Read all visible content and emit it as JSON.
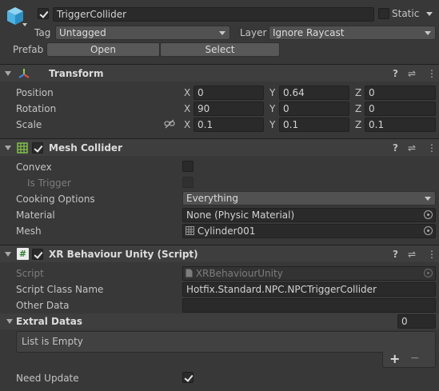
{
  "header": {
    "object_name": "TriggerCollider",
    "static_label": "Static",
    "tag_label": "Tag",
    "tag_value": "Untagged",
    "layer_label": "Layer",
    "layer_value": "Ignore Raycast",
    "prefab_label": "Prefab",
    "open_label": "Open",
    "select_label": "Select"
  },
  "transform": {
    "title": "Transform",
    "position_label": "Position",
    "rotation_label": "Rotation",
    "scale_label": "Scale",
    "axis_x": "X",
    "axis_y": "Y",
    "axis_z": "Z",
    "position": {
      "x": "0",
      "y": "0.64",
      "z": "0"
    },
    "rotation": {
      "x": "90",
      "y": "0",
      "z": "0"
    },
    "scale": {
      "x": "0.1",
      "y": "0.1",
      "z": "0.1"
    }
  },
  "mesh_collider": {
    "title": "Mesh Collider",
    "convex_label": "Convex",
    "is_trigger_label": "Is Trigger",
    "cooking_options_label": "Cooking Options",
    "cooking_options_value": "Everything",
    "material_label": "Material",
    "material_value": "None (Physic Material)",
    "mesh_label": "Mesh",
    "mesh_value": "Cylinder001"
  },
  "xr_behaviour": {
    "title": "XR Behaviour Unity (Script)",
    "script_label": "Script",
    "script_value": "XRBehaviourUnity",
    "script_class_label": "Script Class Name",
    "script_class_value": "Hotfix.Standard.NPC.NPCTriggerCollider",
    "other_data_label": "Other Data",
    "other_data_value": "",
    "extral_datas_label": "Extral Datas",
    "extral_datas_count": "0",
    "list_empty_text": "List is Empty",
    "add_glyph": "+",
    "remove_glyph": "−",
    "need_update_label": "Need Update"
  },
  "icons": {
    "help": "?",
    "settings": "⇌",
    "more": "⋮"
  }
}
